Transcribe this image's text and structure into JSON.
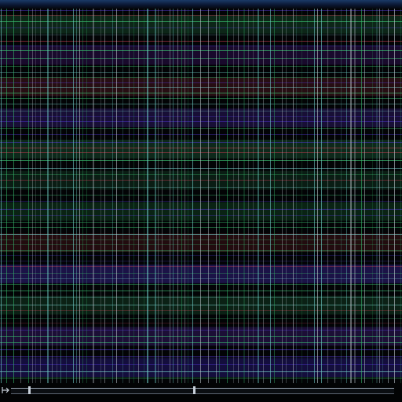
{
  "pattern": {
    "palette": {
      "background": "#040507",
      "green": "#3fd27a",
      "red": "#e0405a",
      "violet": "#5a3cf0",
      "cyan": "#7fe6e0",
      "white": "#d8e2ea"
    },
    "bands": [
      {
        "color": "#3fd27a",
        "strength": 0.55
      },
      {
        "color": "#7a2bd8",
        "strength": 0.6
      },
      {
        "color": "#e0405a",
        "strength": 0.55
      },
      {
        "color": "#6a40f0",
        "strength": 0.7
      },
      {
        "color": "#3fd27a",
        "strength": 0.6
      },
      {
        "color": "#3fd27a",
        "strength": 0.4
      },
      {
        "color": "#2fc060",
        "strength": 0.55
      },
      {
        "color": "#d83a50",
        "strength": 0.5
      },
      {
        "color": "#5a3cf0",
        "strength": 0.9
      },
      {
        "color": "#3fd27a",
        "strength": 0.45
      },
      {
        "color": "#7a40f0",
        "strength": 0.7
      },
      {
        "color": "#4a34e8",
        "strength": 0.8
      }
    ]
  },
  "controls": {
    "scrollbar_icon": "scroll-track",
    "position_icon": "playhead-marker",
    "left_icon": "start-marker-icon"
  }
}
